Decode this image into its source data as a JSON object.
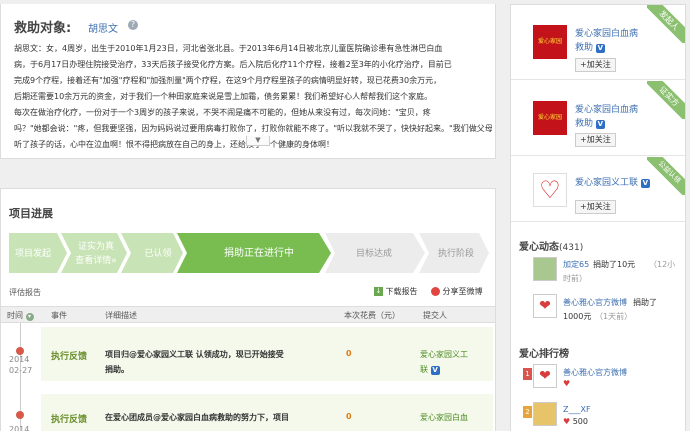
{
  "story": {
    "title": "救助对象:",
    "name": "胡思文",
    "help": "?",
    "lines": [
      "胡思文：女，4周岁，出生于2010年1月23日，河北省张北县。于2013年6月14日被北京儿童医院确诊患有急性淋巴白血",
      "病，于6月17日办理住院接受治疗，33天后孩子接受化疗方案。后入院后化疗11个疗程，接着2至3年的小化疗治疗，目前已",
      "完成9个疗程，接着还有\"加强\"疗程和\"加强剂量\"两个疗程，在这9个月疗程里孩子的病情明显好转，现已花费30余万元，",
      "后期还需要10余万元的资金，对于我们一个种田家庭来说是雪上加霜，债务累累！我们希望好心人帮帮我们这个家庭。",
      "每次在做治疗化疗，一份对于一个3周岁的孩子来说，不哭不闹是痛不可能的，但她从来没有过，每次问她：\"宝贝，疼",
      "吗？\"她都会说：\"疼，但我要坚强，因为妈妈说过要用病毒打败你了，打败你就能不疼了。\"听以我就不哭了，快快好起来。\"我们做父母的",
      "听了孩子的话，心中在泣血啊！恨不得把病放在自己的身上，还给孩子一个健康的身体啊！"
    ]
  },
  "progress": {
    "title": "项目进展",
    "steps": [
      "项目发起",
      "证实为真\n查看详情»",
      "已认领",
      "捐助正在进行中",
      "目标达成",
      "执行阶段"
    ],
    "report_label": "评估报告",
    "download_label": "下载报告",
    "share_label": "分享至微博",
    "columns": [
      "时间",
      "事件",
      "详细描述",
      "本次花费（元）",
      "提交人"
    ],
    "rows": [
      {
        "year": "2014",
        "date": "02-27",
        "event": "执行反馈",
        "desc1": "项目归@爱心家园义工联 认领成功，现已开始接受",
        "desc2": "捐助。",
        "cost": "0",
        "sub1": "爱心家园义工",
        "sub2": "联"
      },
      {
        "year": "2014",
        "date": "",
        "event": "执行反馈",
        "desc1": "在爱心团成员@爱心家园白血病救助的努力下，项目",
        "desc2": "",
        "cost": "0",
        "sub1": "爱心家园白血",
        "sub2": ""
      }
    ]
  },
  "orgs": [
    {
      "tag": "发起人",
      "logo": "爱心家园",
      "name1": "爱心家园白血病",
      "name2": "救助",
      "follow": "+加关注"
    },
    {
      "tag": "证实方",
      "logo": "爱心家园",
      "name1": "爱心家园白血病",
      "name2": "救助",
      "follow": "+加关注"
    },
    {
      "tag": "公益认领",
      "logo": "",
      "name1": "爱心家园义工联",
      "name2": "",
      "follow": "+加关注"
    }
  ],
  "feed": {
    "title": "爱心动态",
    "count": "(431)",
    "items": [
      {
        "user": "加定65",
        "action": "捐助了10元",
        "time": "（12小",
        "time2": "时前）"
      },
      {
        "user": "善心雅心官方微博",
        "action": "捐助了",
        "time": "1000元",
        "time2": "（1天前）"
      }
    ]
  },
  "ranking": {
    "title": "爱心排行榜",
    "items": [
      {
        "rank": "1",
        "name": "善心雅心官方微博",
        "score": ""
      },
      {
        "rank": "2",
        "name": "Z___XF",
        "score": "500"
      }
    ]
  }
}
